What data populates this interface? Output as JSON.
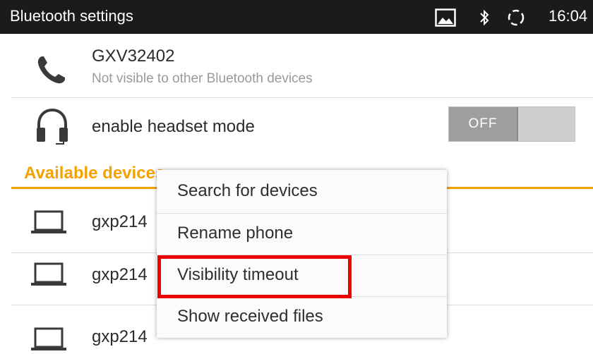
{
  "status_bar": {
    "title": "Bluetooth settings",
    "time": "16:04",
    "icons": [
      "image-icon",
      "bluetooth-icon",
      "sync-icon"
    ]
  },
  "device": {
    "name": "GXV32402",
    "visibility": "Not visible to other Bluetooth devices",
    "icon": "phone-icon"
  },
  "headset": {
    "label": "enable headset mode",
    "toggle_label": "OFF",
    "icon": "headset-icon"
  },
  "available_devices": {
    "header": "Available devices",
    "items": [
      {
        "name": "gxp214",
        "icon": "laptop-icon"
      },
      {
        "name": "gxp214",
        "icon": "laptop-icon"
      },
      {
        "name": "gxp214",
        "icon": "laptop-icon"
      }
    ]
  },
  "menu": {
    "items": [
      {
        "label": "Search for devices"
      },
      {
        "label": "Rename phone"
      },
      {
        "label": "Visibility timeout"
      },
      {
        "label": "Show received files"
      }
    ],
    "highlighted_item": "Visibility timeout"
  },
  "colors": {
    "accent": "#f5a100",
    "highlight": "#ec0000",
    "status_bar": "#1b1b1b"
  }
}
